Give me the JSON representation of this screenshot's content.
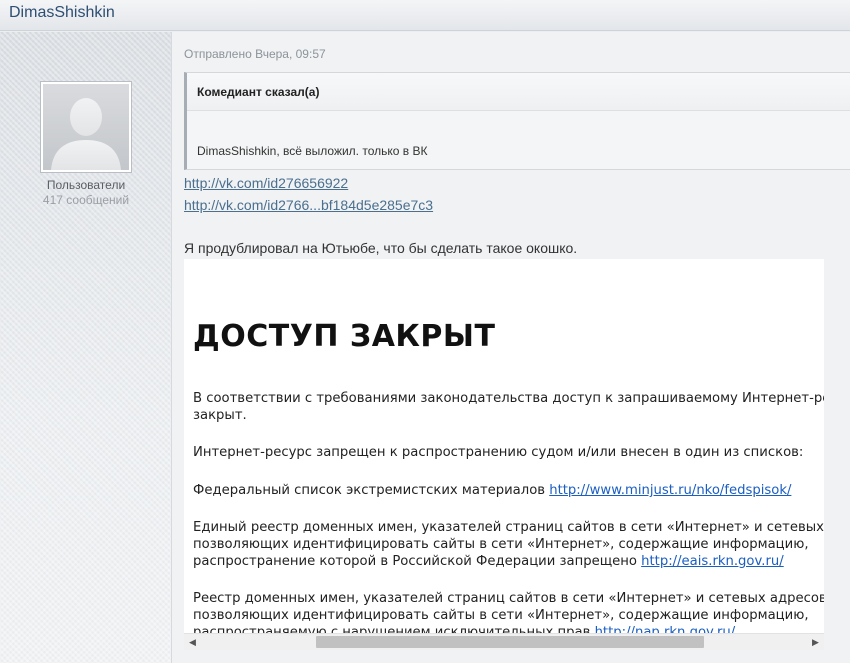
{
  "header": {
    "author": "DimasShishkin"
  },
  "sidebar": {
    "group": "Пользователи",
    "posts": "417 сообщений"
  },
  "post": {
    "date": "Отправлено Вчера, 09:57",
    "quote": {
      "author": "Комедиант сказал(а)",
      "text": "DimasShishkin, всё выложил. только в ВК"
    },
    "links": [
      "http://vk.com/id276656922",
      "http://vk.com/id2766...bf184d5e285e7c3"
    ],
    "text": "Я продублировал на Ютьюбе, что бы сделать такое окошко."
  },
  "embed": {
    "title": "ДОСТУП ЗАКРЫТ",
    "p1_line1": "В соответствии с требованиями законодательства доступ к запрашиваемому Интернет-ресурсу",
    "p1_line2": "закрыт.",
    "p2": "Интернет-ресурс запрещен к распространению судом и/или внесен в один из списков:",
    "p3_text": "Федеральный список экстремистских материалов ",
    "p3_link": "http://www.minjust.ru/nko/fedspisok/",
    "p4_line1": "Единый реестр доменных имен, указателей страниц сайтов в сети «Интернет» и сетевых адресов,",
    "p4_line2": "позволяющих идентифицировать сайты в сети «Интернет», содержащие информацию,",
    "p4_line3": "распространение которой в Российской Федерации запрещено ",
    "p4_link": "http://eais.rkn.gov.ru/",
    "p5_line1": "Реестр доменных имен, указателей страниц сайтов в сети «Интернет» и сетевых адресов,",
    "p5_line2": "позволяющих идентифицировать сайты в сети «Интернет», содержащие информацию,",
    "p5_line3": "распространяемую с нарушением исключительных прав ",
    "p5_link": "http://nap.rkn.gov.ru/"
  },
  "icons": {
    "scroll_left": "arrow-left-icon",
    "scroll_right": "arrow-right-icon"
  }
}
